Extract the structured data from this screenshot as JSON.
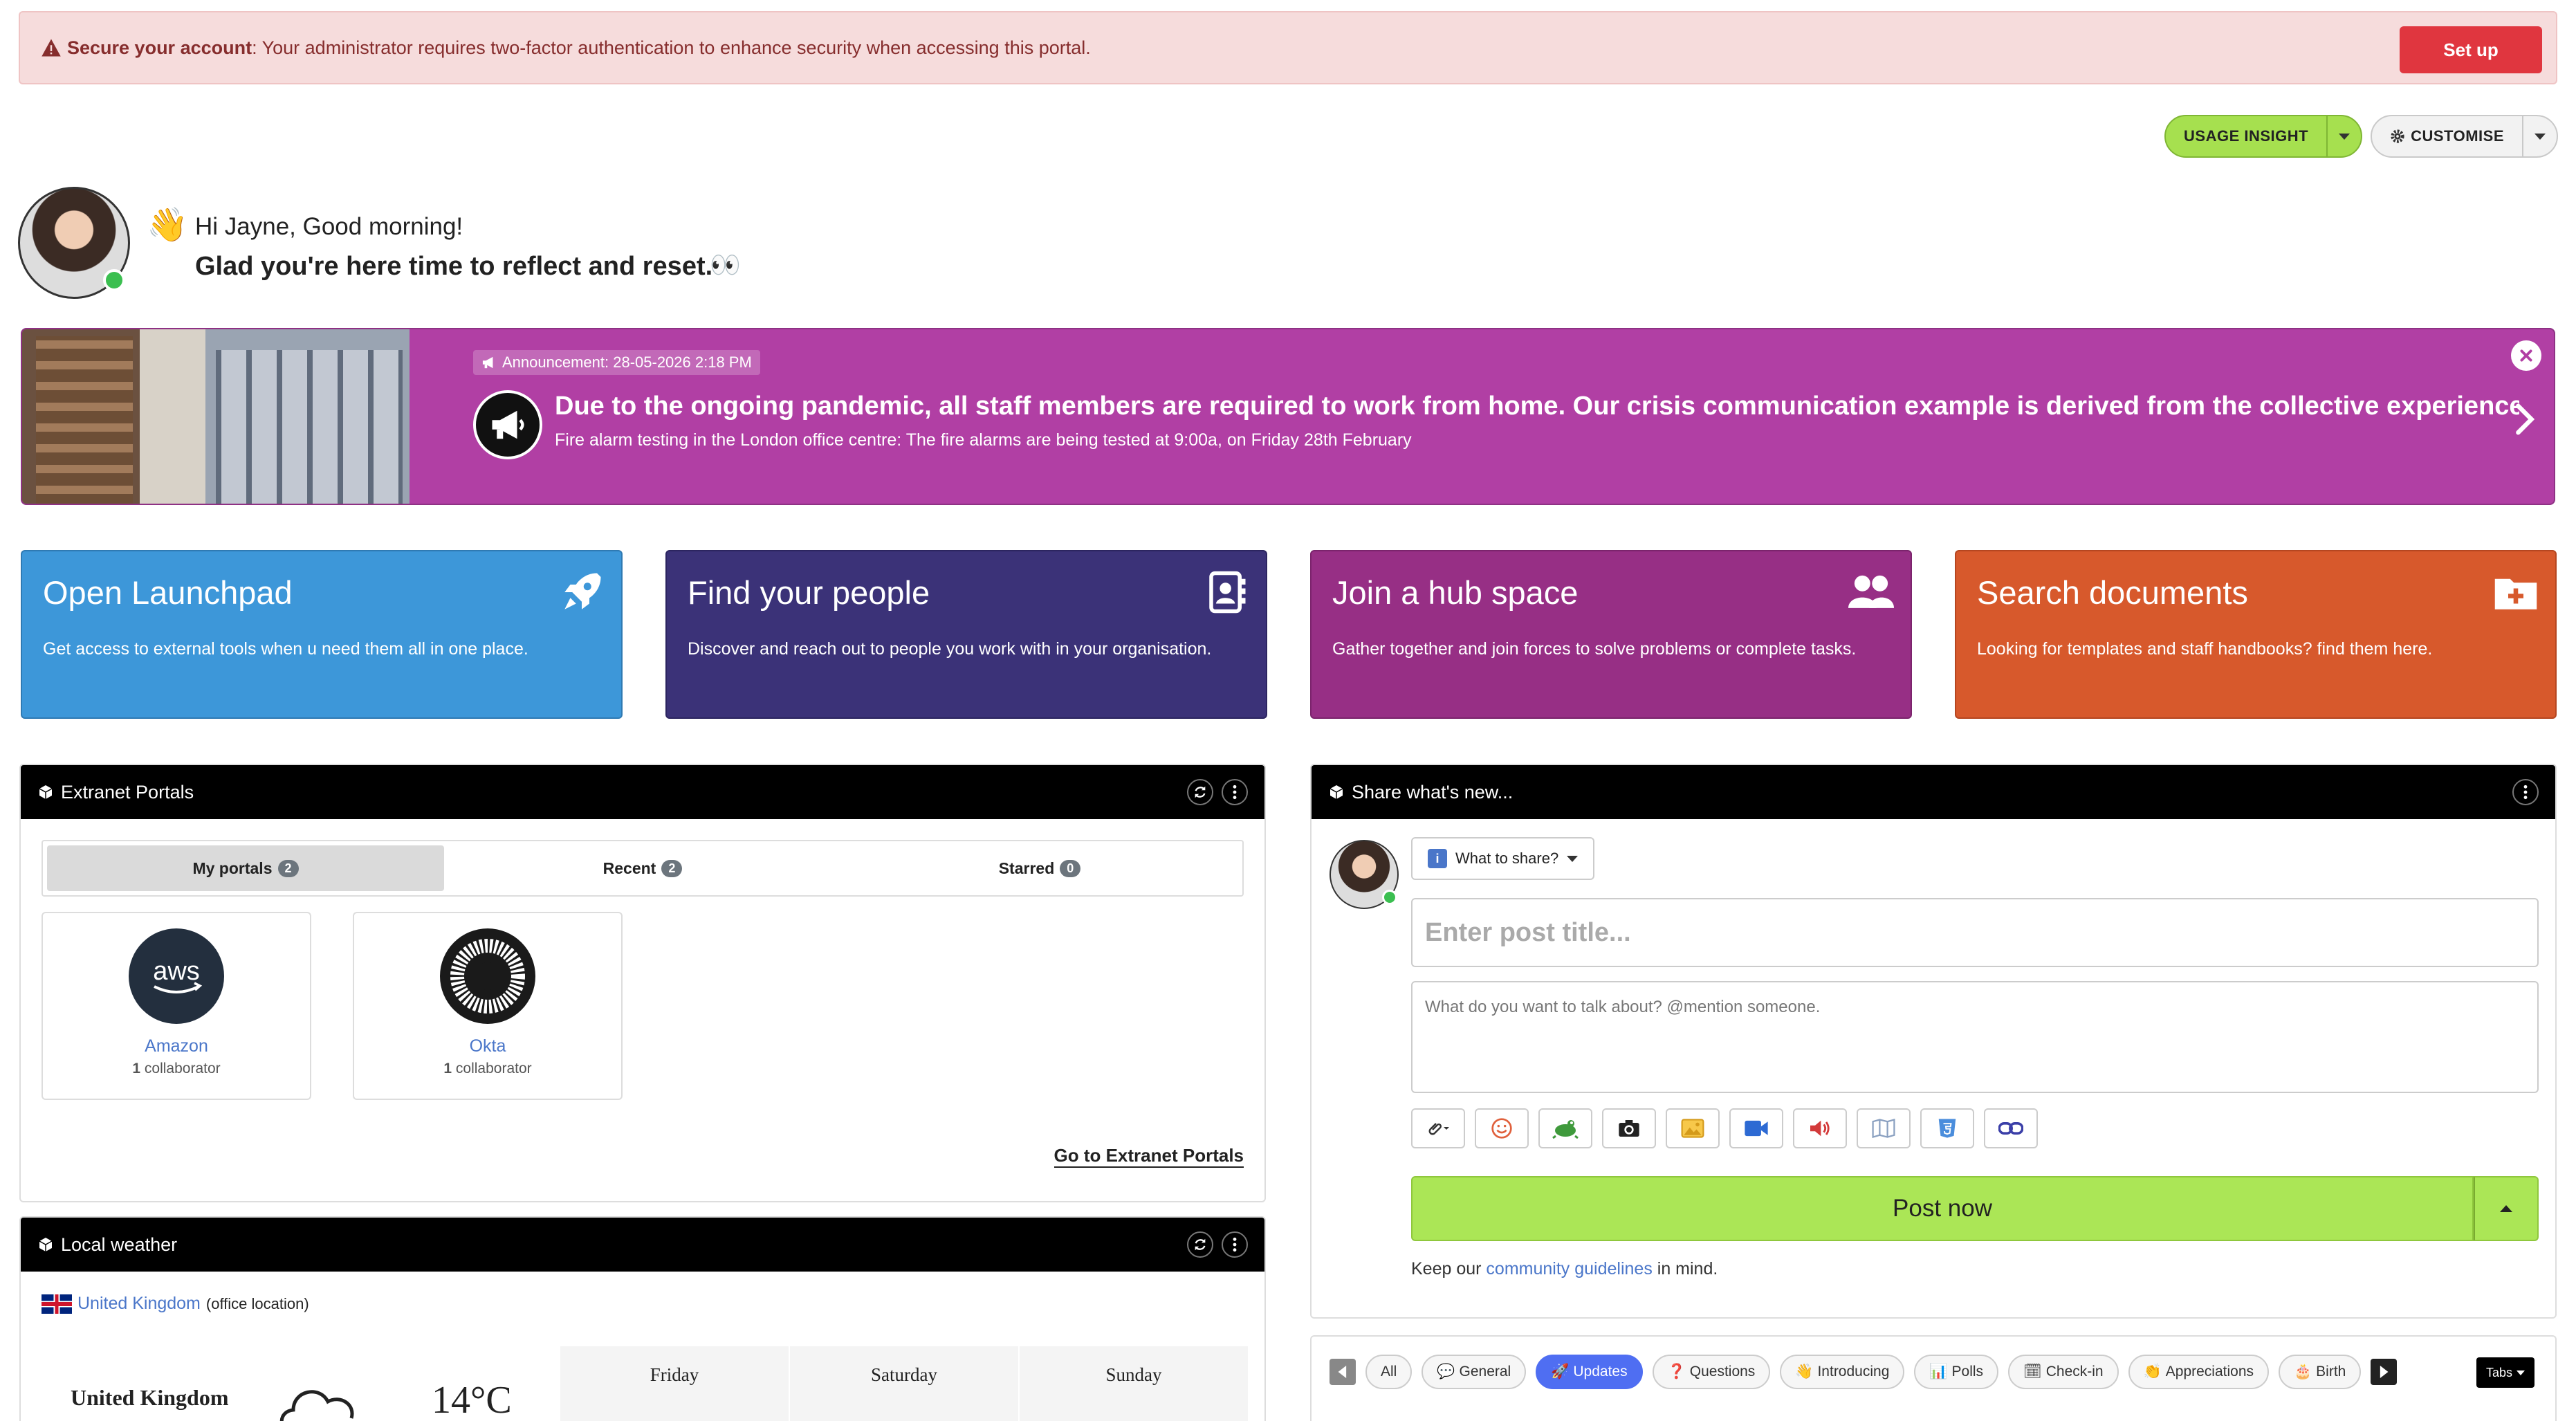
{
  "alert": {
    "title": "Secure your account",
    "message": ": Your administrator requires two-factor authentication to enhance security when accessing this portal.",
    "button": "Set up"
  },
  "toolbar": {
    "usage_label": "USAGE INSIGHT",
    "customise_label": "CUSTOMISE"
  },
  "greeting": {
    "line1": "Hi Jayne, Good morning!",
    "line2": "Glad you're here time to reflect and reset.",
    "wave_emoji": "👋",
    "eyes_emoji": "👀"
  },
  "announcement": {
    "tag": "Announcement: 28-05-2026 2:18 PM",
    "headline": "Due to the ongoing pandemic, all staff members are required to work from home. Our crisis communication example is derived from the collective experiences of",
    "subtext": "Fire alarm testing in the London office centre: The fire alarms are being tested at 9:00a, on Friday 28th February"
  },
  "tiles": [
    {
      "title": "Open Launchpad",
      "desc": "Get access to external tools when u need them all in one place.",
      "icon": "rocket-icon",
      "color": "#3d97d9"
    },
    {
      "title": "Find your people",
      "desc": "Discover and reach out to people you work with in your organisation.",
      "icon": "address-book-icon",
      "color": "#3b3278"
    },
    {
      "title": "Join a hub space",
      "desc": "Gather together and join forces to solve problems or complete tasks.",
      "icon": "users-icon",
      "color": "#972f85"
    },
    {
      "title": "Search documents",
      "desc": "Looking for templates and staff handbooks? find them here.",
      "icon": "folder-plus-icon",
      "color": "#d7592c"
    }
  ],
  "extranet": {
    "title": "Extranet Portals",
    "tabs": [
      {
        "label": "My portals",
        "count": "2"
      },
      {
        "label": "Recent",
        "count": "2"
      },
      {
        "label": "Starred",
        "count": "0"
      }
    ],
    "portals": [
      {
        "name": "Amazon",
        "count": "1",
        "suffix": " collaborator",
        "logo_text": "aws"
      },
      {
        "name": "Okta",
        "count": "1",
        "suffix": " collaborator"
      }
    ],
    "link": "Go to Extranet Portals"
  },
  "weather": {
    "title": "Local weather",
    "country": "United Kingdom",
    "office_note": " (office location)",
    "city": "United Kingdom",
    "temp": "14°C",
    "days": [
      "Friday",
      "Saturday",
      "Sunday"
    ]
  },
  "share": {
    "title": "Share what's new...",
    "what_label": "What to share?",
    "title_placeholder": "Enter post title...",
    "body_placeholder": "What do you want to talk about? @mention someone.",
    "post_label": "Post now",
    "guide_prefix": "Keep our ",
    "guide_link": "community guidelines",
    "guide_suffix": " in mind."
  },
  "filters": {
    "chips": [
      {
        "label": "All",
        "icon": ""
      },
      {
        "label": "General",
        "icon": "💬"
      },
      {
        "label": "Updates",
        "icon": "🚀"
      },
      {
        "label": "Questions",
        "icon": "❓"
      },
      {
        "label": "Introducing",
        "icon": "👋"
      },
      {
        "label": "Polls",
        "icon": "📊"
      },
      {
        "label": "Check-in",
        "icon": "🗓"
      },
      {
        "label": "Appreciations",
        "icon": "👏"
      },
      {
        "label": "Birth",
        "icon": "🎂"
      }
    ],
    "tabs_label": "Tabs"
  }
}
